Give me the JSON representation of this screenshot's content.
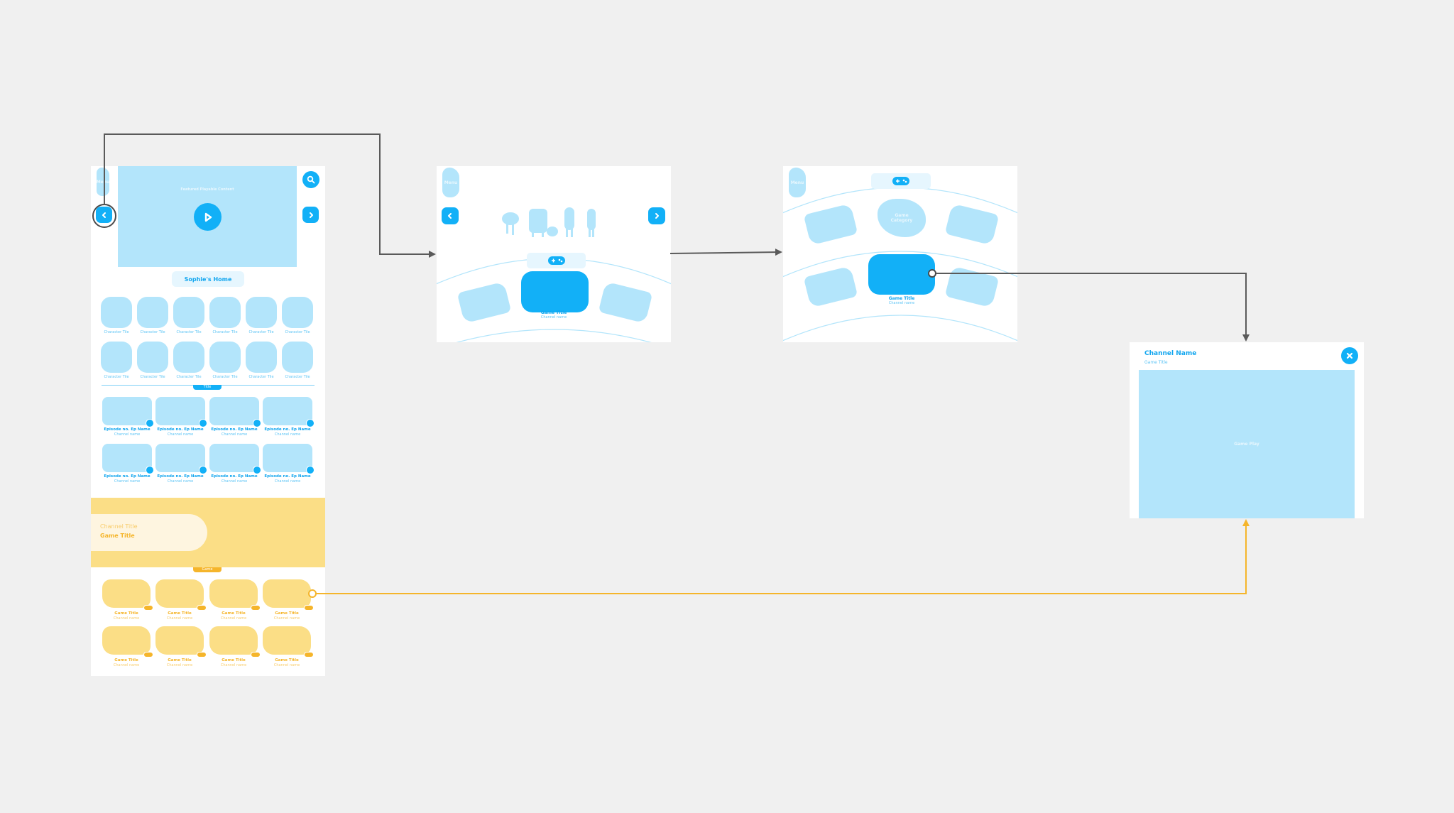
{
  "colors": {
    "background": "#f0f0f0",
    "primary_blue": "#12b0f7",
    "light_blue": "#b3e5fb",
    "pale_blue": "#e6f6fe",
    "yellow": "#fbde86",
    "pale_yellow": "#fef5e0",
    "accent_yellow": "#f5b52b",
    "connector_gray": "#5a5a5a"
  },
  "home_screen": {
    "menu_label": "Menu",
    "featured_label": "Featured Playable Content",
    "title_pill": "Sophie's Home",
    "icons": {
      "search": "search-icon",
      "prev": "chevron-left-icon",
      "next": "chevron-right-icon",
      "play": "play-icon"
    },
    "character_tiles": [
      "Character Tile",
      "Character Tile",
      "Character Tile",
      "Character Tile",
      "Character Tile",
      "Character Tile",
      "Character Tile",
      "Character Tile",
      "Character Tile",
      "Character Tile",
      "Character Tile",
      "Character Tile"
    ],
    "episodes_section_tab": "Title",
    "episodes": [
      {
        "title": "Episode no. Ep Name",
        "channel": "Channel name"
      },
      {
        "title": "Episode no. Ep Name",
        "channel": "Channel name"
      },
      {
        "title": "Episode no. Ep Name",
        "channel": "Channel name"
      },
      {
        "title": "Episode no. Ep Name",
        "channel": "Channel name"
      },
      {
        "title": "Episode no. Ep Name",
        "channel": "Channel name"
      },
      {
        "title": "Episode no. Ep Name",
        "channel": "Channel name"
      },
      {
        "title": "Episode no. Ep Name",
        "channel": "Channel name"
      },
      {
        "title": "Episode no. Ep Name",
        "channel": "Channel name"
      }
    ],
    "banner": {
      "channel_title": "Channel Title",
      "game_title": "Game Title"
    },
    "games_section_tab": "Game",
    "games": [
      {
        "title": "Game Title",
        "channel": "Channel name"
      },
      {
        "title": "Game Title",
        "channel": "Channel name"
      },
      {
        "title": "Game Title",
        "channel": "Channel name"
      },
      {
        "title": "Game Title",
        "channel": "Channel name"
      },
      {
        "title": "Game Title",
        "channel": "Channel name"
      },
      {
        "title": "Game Title",
        "channel": "Channel name"
      },
      {
        "title": "Game Title",
        "channel": "Channel name"
      },
      {
        "title": "Game Title",
        "channel": "Channel name"
      }
    ]
  },
  "character_screen": {
    "menu_label": "Menu",
    "featured_game": {
      "title": "Game Title",
      "channel": "Channel name"
    }
  },
  "games_screen": {
    "menu_label": "Menu",
    "category_label": "Game Category",
    "selected_game": {
      "title": "Game Title",
      "channel": "Channel name"
    }
  },
  "game_modal": {
    "channel_name": "Channel Name",
    "game_title": "Game Title",
    "play_area_label": "Game Play",
    "close_icon": "close-icon"
  }
}
